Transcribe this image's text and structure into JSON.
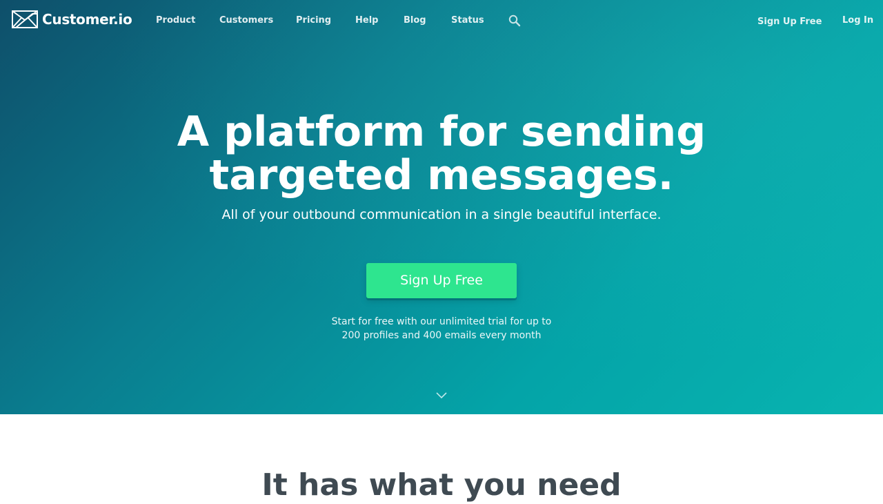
{
  "nav": {
    "logo_text": "Customer.io",
    "links": [
      "Product",
      "Customers",
      "Pricing",
      "Help",
      "Blog",
      "Status"
    ],
    "signup": "Sign Up Free",
    "login": "Log In"
  },
  "hero": {
    "title_line1": "A platform for sending",
    "title_line2": "targeted messages.",
    "subtitle": "All of your outbound communication in a single beautiful interface.",
    "cta": "Sign Up Free",
    "note_line1": "Start for free with our unlimited trial for up to",
    "note_line2": "200 profiles and 400 emails every month"
  },
  "section": {
    "title": "It has what you need"
  },
  "colors": {
    "gradient_start": "#0e4f6a",
    "gradient_end": "#08b4b0",
    "cta": "#2ee58f",
    "section_title": "#3f4a52"
  },
  "icons": [
    "envelope-logo-icon",
    "search-icon",
    "chevron-down-icon"
  ]
}
